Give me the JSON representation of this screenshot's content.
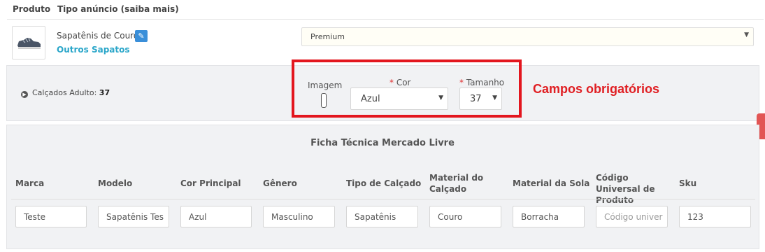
{
  "header": {
    "col_product": "Produto",
    "col_listing_type": "Tipo anúncio (saiba mais)"
  },
  "product": {
    "thumbnail_icon": "shoe-icon",
    "name": "Sapatênis de Couro",
    "edit_icon": "edit-icon",
    "category": "Outros Sapatos"
  },
  "listing_type": {
    "selected": "Premium"
  },
  "variant": {
    "crumb_label": "Calçados Adulto:",
    "crumb_value": "37",
    "image_label": "Imagem",
    "color_label": "Cor",
    "color_value": "Azul",
    "size_label": "Tamanho",
    "size_value": "37",
    "required_marker": "*",
    "annotation": "Campos obrigatórios",
    "annotation_color": "#e01e22"
  },
  "tech_sheet": {
    "title": "Ficha Técnica Mercado Livre",
    "columns": [
      {
        "label": "Marca",
        "value": "Teste",
        "placeholder": ""
      },
      {
        "label": "Modelo",
        "value": "Sapatênis Tes",
        "placeholder": ""
      },
      {
        "label": "Cor Principal",
        "value": "Azul",
        "placeholder": ""
      },
      {
        "label": "Gênero",
        "value": "Masculino",
        "placeholder": ""
      },
      {
        "label": "Tipo de Calçado",
        "value": "Sapatênis",
        "placeholder": ""
      },
      {
        "label": "Material do Calçado",
        "value": "Couro",
        "placeholder": ""
      },
      {
        "label": "Material da Sola",
        "value": "Borracha",
        "placeholder": ""
      },
      {
        "label": "Código Universal de Produto",
        "value": "",
        "placeholder": "Código univer"
      },
      {
        "label": "Sku",
        "value": "123",
        "placeholder": ""
      }
    ]
  }
}
